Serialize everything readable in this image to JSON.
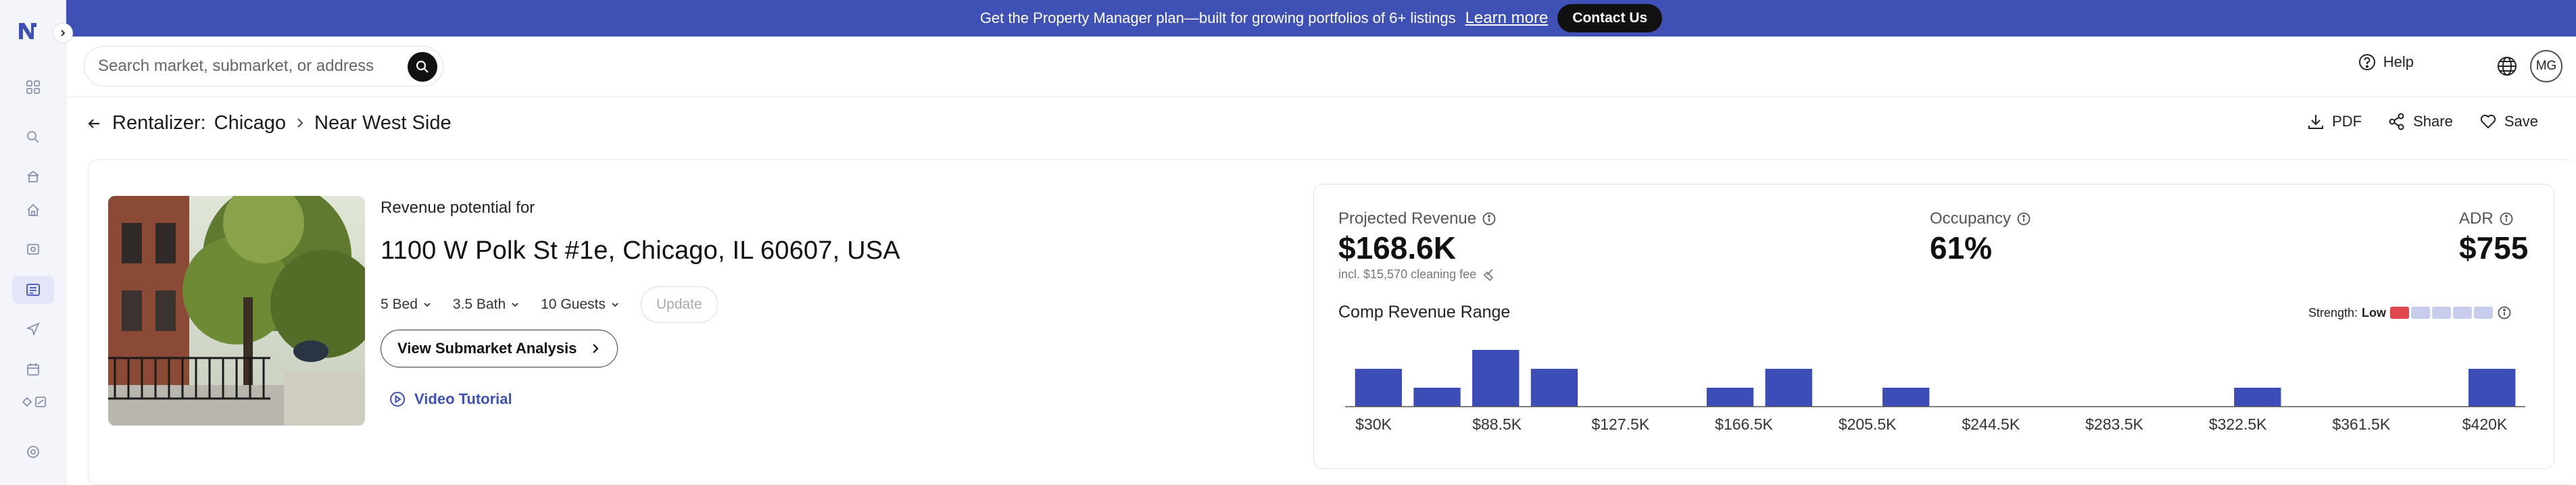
{
  "banner": {
    "text": "Get the Property Manager plan—built for growing portfolios of 6+ listings",
    "learn_more": "Learn more",
    "contact": "Contact Us"
  },
  "header": {
    "search_placeholder": "Search market, submarket, or address",
    "help": "Help",
    "avatar": "MG"
  },
  "breadcrumb": {
    "root": "Rentalizer:",
    "city": "Chicago",
    "area": "Near West Side"
  },
  "actions": {
    "pdf": "PDF",
    "share": "Share",
    "save": "Save"
  },
  "property": {
    "revenue_for": "Revenue potential for",
    "address": "1100 W Polk St #1e, Chicago, IL 60607, USA",
    "beds": "5 Bed",
    "baths": "3.5 Bath",
    "guests": "10 Guests",
    "update": "Update",
    "submarket_button": "View Submarket Analysis",
    "video": "Video Tutorial"
  },
  "stats": {
    "projected_label": "Projected Revenue",
    "projected_value": "$168.6K",
    "cleaning_fee": "incl. $15,570 cleaning fee",
    "occupancy_label": "Occupancy",
    "occupancy_value": "61%",
    "adr_label": "ADR",
    "adr_value": "$755"
  },
  "comp": {
    "title": "Comp Revenue Range",
    "strength_label": "Strength:",
    "strength_value": "Low",
    "strength_level": 1,
    "strength_max": 5
  },
  "colors": {
    "accent": "#3f51b5",
    "bar": "#3d4db7",
    "low": "#e0474c"
  },
  "chart_data": {
    "type": "bar",
    "tick_labels": [
      "$30K",
      "$88.5K",
      "$127.5K",
      "$166.5K",
      "$205.5K",
      "$244.5K",
      "$283.5K",
      "$322.5K",
      "$361.5K",
      "$420K"
    ],
    "bins": [
      "b1",
      "b2",
      "b3",
      "b4",
      "b5",
      "b6",
      "b7",
      "b8",
      "b9",
      "b10",
      "b11",
      "b12",
      "b13",
      "b14",
      "b15",
      "b16",
      "b17",
      "b18",
      "b19",
      "b20"
    ],
    "counts": [
      2,
      1,
      3,
      2,
      0,
      0,
      1,
      2,
      0,
      1,
      0,
      0,
      0,
      0,
      0,
      1,
      0,
      0,
      0,
      2
    ]
  }
}
